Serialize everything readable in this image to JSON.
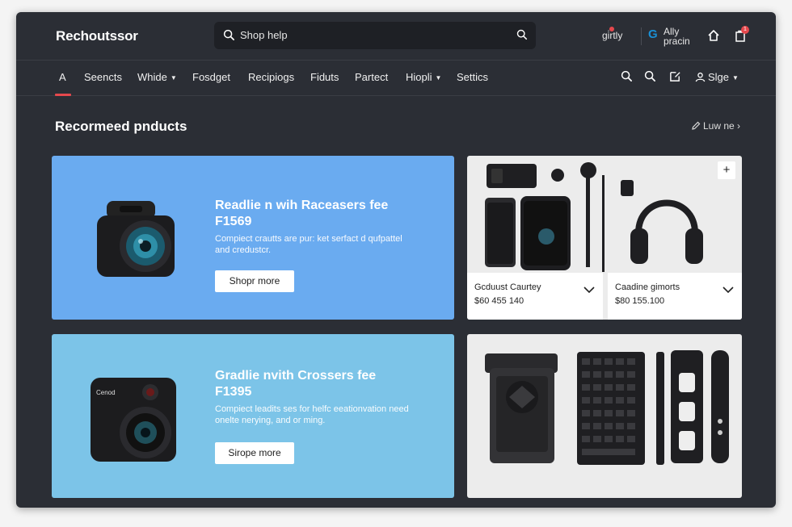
{
  "app": {
    "brand": "Rechoutssor"
  },
  "search": {
    "placeholder": "Shop help"
  },
  "account": {
    "label1": "gi̇rtly",
    "g_logo": "G",
    "label2_line1": "Ally",
    "label2_line2": "pracin",
    "notification_count": "1"
  },
  "nav": {
    "items": [
      {
        "label": "A"
      },
      {
        "label": "Seencts"
      },
      {
        "label": "Whide"
      },
      {
        "label": "Fosdget"
      },
      {
        "label": "Recipiogs"
      },
      {
        "label": "Fiduts"
      },
      {
        "label": "Partect"
      },
      {
        "label": "Hiopli"
      },
      {
        "label": "Settics"
      }
    ],
    "signin_label": "Slge"
  },
  "section": {
    "title": "Recormeed pnducts",
    "view_more": "Luw ne"
  },
  "promos": [
    {
      "title_line1": "Readlie n wih Raceasers fee",
      "title_line2": "F1569",
      "desc_line1": "Compiect crautts are pur: ket serfact d qufpattel",
      "desc_line2": "and credustcr.",
      "button": "Shopr more"
    },
    {
      "title_line1": "Gradlie nvith Crossers fee",
      "title_line2": "F1395",
      "desc_line1": "Compiect leadits ses for helfc eeationvation need",
      "desc_line2": "onelte nerying, and or ming.",
      "button": "Sirope more"
    }
  ],
  "products": [
    {
      "name": "Gcduust Caurtey",
      "price": "$60 455 140"
    },
    {
      "name": "Caadine gimorts",
      "price": "$80 155.100"
    }
  ],
  "colors": {
    "window_bg": "#2b2e35",
    "accent": "#e5484d",
    "promo1_bg": "#6aabf0",
    "promo2_bg": "#7cc4e8",
    "g_logo": "#1a8fd4"
  }
}
